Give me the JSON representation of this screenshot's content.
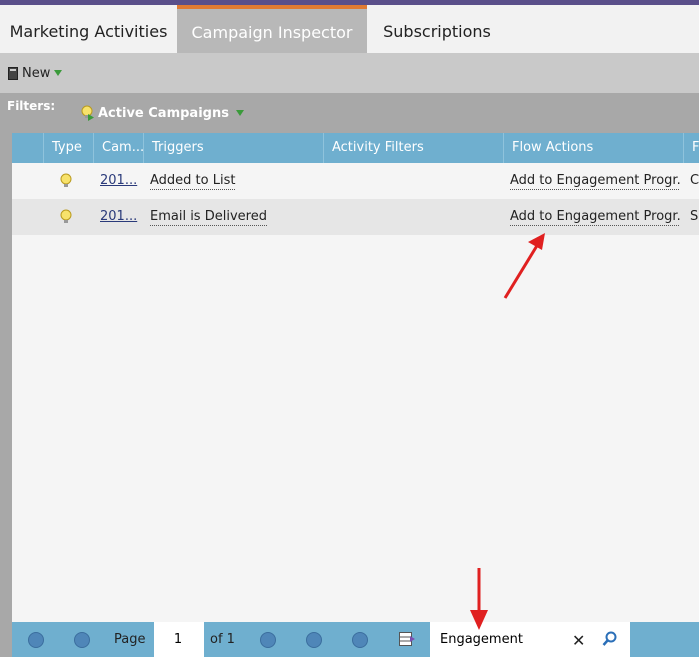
{
  "tabs": [
    {
      "label": "Marketing Activities",
      "active": false
    },
    {
      "label": "Campaign Inspector",
      "active": true
    },
    {
      "label": "Subscriptions",
      "active": false
    }
  ],
  "toolbar": {
    "new_label": "New"
  },
  "filters": {
    "label": "Filters:",
    "active_filter": "Active Campaigns"
  },
  "grid": {
    "columns": [
      "Type",
      "Cam...",
      "Triggers",
      "Activity Filters",
      "Flow Actions",
      "F"
    ],
    "rows": [
      {
        "type_icon": "lightbulb-icon",
        "campaign": "201...",
        "trigger": "Added to List",
        "activity_filters": "",
        "flow_action": "Add to Engagement Progr...",
        "extra": "C"
      },
      {
        "type_icon": "lightbulb-icon",
        "campaign": "201...",
        "trigger": "Email is Delivered",
        "activity_filters": "",
        "flow_action": "Add to Engagement Progr...",
        "extra": "Su"
      }
    ]
  },
  "pager": {
    "page_label": "Page",
    "page_value": "1",
    "of_label": "of 1",
    "search_value": "Engagement"
  },
  "colors": {
    "accent": "#e17b32",
    "header": "#6fafcf",
    "annotation": "#e02020"
  }
}
